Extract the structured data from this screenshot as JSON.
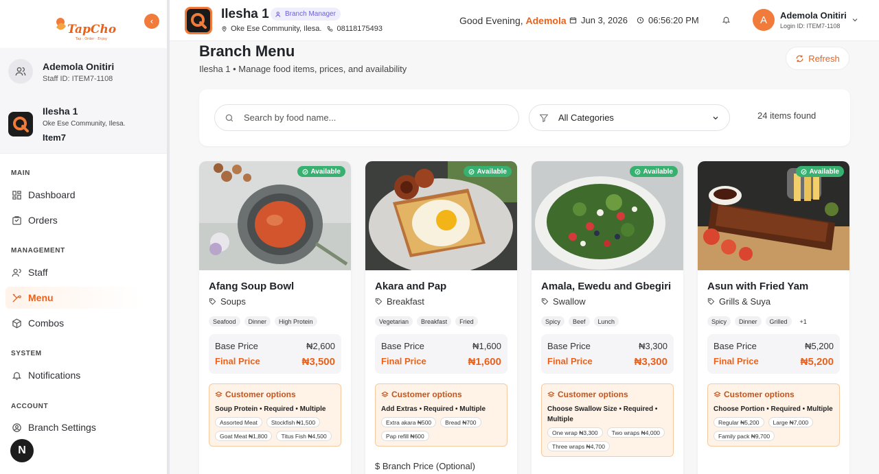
{
  "brand": {
    "name": "TapChow",
    "tagline": "Tap · Order · Enjoy"
  },
  "sidebar": {
    "user": {
      "name": "Ademola Onitiri",
      "staff_id": "Staff ID: ITEM7-1108"
    },
    "branch": {
      "name": "Ilesha 1",
      "address": "Oke Ese Community, Ilesa.",
      "code": "Item7"
    },
    "sections": {
      "main": "MAIN",
      "management": "MANAGEMENT",
      "system": "SYSTEM",
      "account": "ACCOUNT"
    },
    "items": {
      "dashboard": "Dashboard",
      "orders": "Orders",
      "staff": "Staff",
      "menu": "Menu",
      "combos": "Combos",
      "notifications": "Notifications",
      "branch_settings": "Branch Settings"
    },
    "badge": "N"
  },
  "header": {
    "branch_name": "Ilesha 1",
    "role": "Branch Manager",
    "address": "Oke Ese Community, Ilesa.",
    "phone": "08118175493",
    "greeting": "Good Evening,",
    "greeting_name": "Ademola",
    "date": "Jun 3, 2026",
    "time": "06:56:20 PM",
    "user_initial": "A",
    "user_name": "Ademola Onitiri",
    "login_id": "Login ID: ITEM7-1108"
  },
  "page": {
    "title": "Branch Menu",
    "subtitle": "Ilesha 1 • Manage food items, prices, and availability",
    "refresh": "Refresh"
  },
  "filters": {
    "search_placeholder": "Search by food name...",
    "category": "All Categories",
    "count": "24 items found"
  },
  "labels": {
    "available": "Available",
    "base_price": "Base Price",
    "final_price": "Final Price",
    "customer_options": "Customer options",
    "branch_price": "Branch Price (Optional)"
  },
  "cards": [
    {
      "name": "Afang Soup Bowl",
      "category": "Soups",
      "tags": [
        "Seafood",
        "Dinner",
        "High Protein"
      ],
      "base": "₦2,600",
      "final": "₦3,500",
      "option_group": "Soup Protein • Required • Multiple",
      "options": [
        "Assorted Meat",
        "Stockfish ₦1,500",
        "Goat Meat ₦1,800",
        "Titus Fish ₦4,500"
      ]
    },
    {
      "name": "Akara and Pap",
      "category": "Breakfast",
      "tags": [
        "Vegetarian",
        "Breakfast",
        "Fried"
      ],
      "base": "₦1,600",
      "final": "₦1,600",
      "option_group": "Add Extras • Required • Multiple",
      "options": [
        "Extra akara ₦500",
        "Bread ₦700",
        "Pap refill ₦600"
      ]
    },
    {
      "name": "Amala, Ewedu and Gbegiri",
      "category": "Swallow",
      "tags": [
        "Spicy",
        "Beef",
        "Lunch"
      ],
      "base": "₦3,300",
      "final": "₦3,300",
      "option_group": "Choose Swallow Size • Required • Multiple",
      "options": [
        "One wrap ₦3,300",
        "Two wraps ₦4,000",
        "Three wraps ₦4,700"
      ]
    },
    {
      "name": "Asun with Fried Yam",
      "category": "Grills & Suya",
      "tags": [
        "Spicy",
        "Dinner",
        "Grilled",
        "+1"
      ],
      "base": "₦5,200",
      "final": "₦5,200",
      "option_group": "Choose Portion • Required • Multiple",
      "options": [
        "Regular ₦5,200",
        "Large ₦7,000",
        "Family pack ₦9,700"
      ]
    }
  ]
}
